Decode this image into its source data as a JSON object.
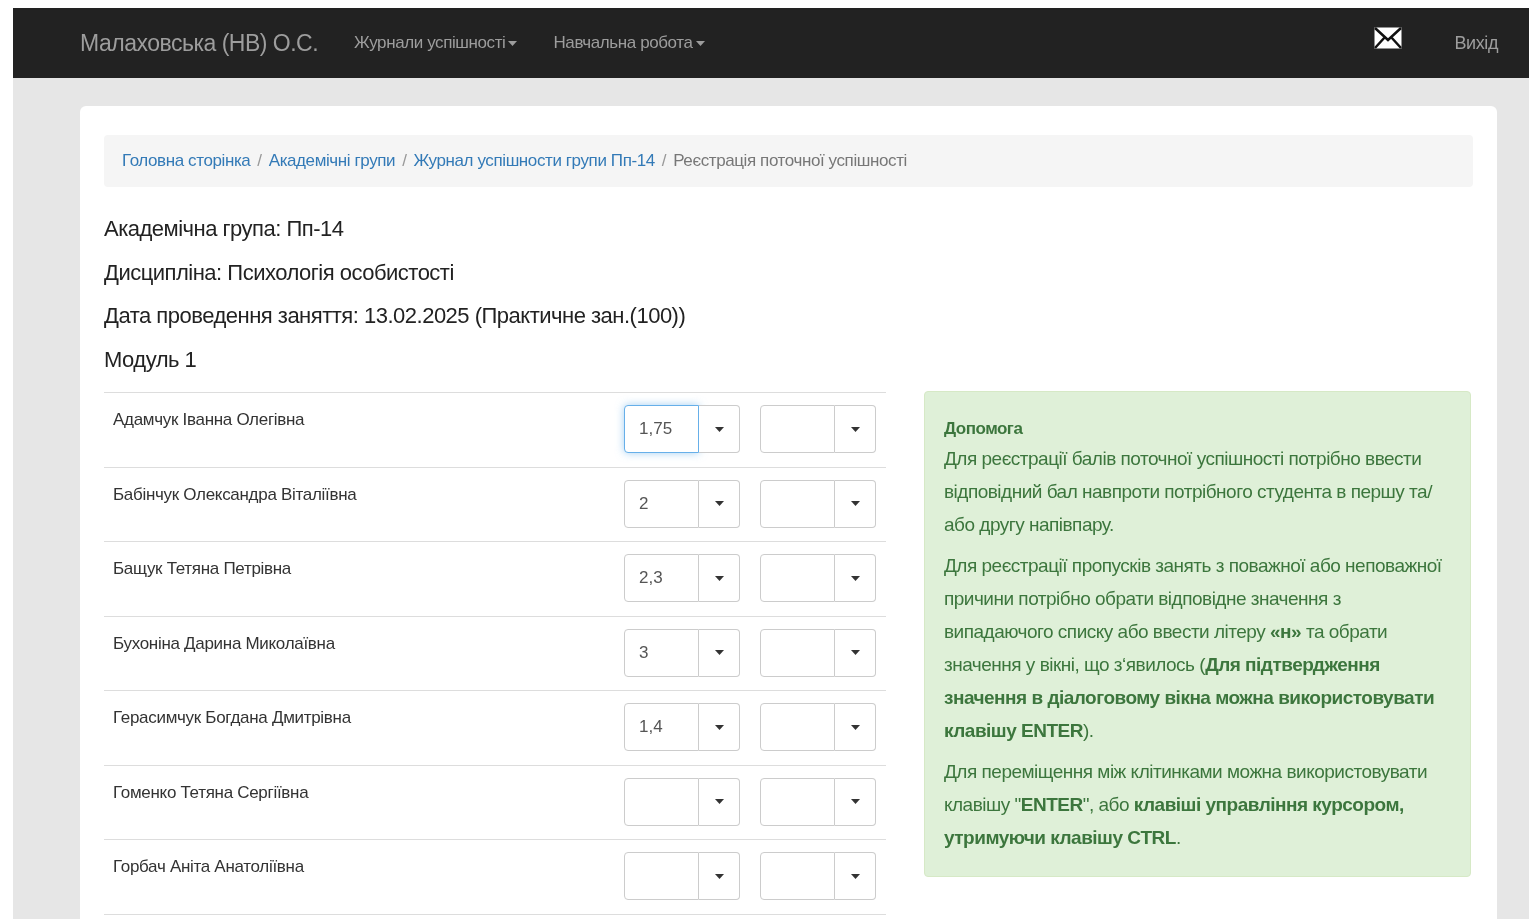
{
  "navbar": {
    "brand": "Малаховська (НВ) О.С.",
    "menus": [
      {
        "label": "Журнали успішності"
      },
      {
        "label": "Навчальна робота"
      }
    ],
    "logout": "Вихід"
  },
  "breadcrumb_separator": "/",
  "breadcrumb": [
    {
      "label": "Головна сторінка",
      "kind": "link"
    },
    {
      "label": "Академічні групи",
      "kind": "link"
    },
    {
      "label": "Журнал успішности групи Пп-14",
      "kind": "link"
    },
    {
      "label": "Реєстрація поточної успішності",
      "kind": "current"
    }
  ],
  "info": [
    "Академічна група: Пп-14",
    "Дисципліна: Психологія особистості",
    "Дата проведення заняття: 13.02.2025 (Практичне зан.(100))",
    "Модуль 1"
  ],
  "students": [
    {
      "name": "Адамчук Іванна Олегівна",
      "grades": [
        {
          "value": "1,75",
          "focused": true
        },
        {
          "focused": false
        }
      ]
    },
    {
      "name": "Бабінчук Олександра Віталіївна",
      "grades": [
        {
          "value": "2",
          "focused": false
        },
        {
          "focused": false
        }
      ]
    },
    {
      "name": "Бащук Тетяна Петрівна",
      "grades": [
        {
          "value": "2,3",
          "focused": false
        },
        {
          "focused": false
        }
      ]
    },
    {
      "name": "Бухоніна Дарина Миколаївна",
      "grades": [
        {
          "value": "3",
          "focused": false
        },
        {
          "focused": false
        }
      ]
    },
    {
      "name": "Герасимчук Богдана Дмитрівна",
      "grades": [
        {
          "value": "1,4",
          "focused": false
        },
        {
          "focused": false
        }
      ]
    },
    {
      "name": "Гоменко Тетяна Сергіївна",
      "grades": [
        {
          "focused": false
        },
        {
          "focused": false
        }
      ]
    },
    {
      "name": "Горбач Аніта Анатоліївна",
      "grades": [
        {
          "focused": false
        },
        {
          "focused": false
        }
      ]
    }
  ],
  "help": {
    "title": "Допомога",
    "paragraphs": [
      "Для реєстрації балів поточної успішності потрібно ввести відповідний бал навпроти потрібного студента в першу та/або другу напівпару.",
      "Для реєстрації пропусків занять з поважної або неповажної причини потрібно обрати відповідне значення з випадаючого списку або ввести літеру **«н»** та обрати значення у вікні, що з‘явилось (**Для підтвердження значення в діалоговому вікна можна використовувати клавішу ENTER**).",
      "Для переміщення між клітинками можна використовувати клавішу \"**ENTER**\", або **клавіші управління курсором, утримуючи клавішу CTRL**."
    ]
  }
}
